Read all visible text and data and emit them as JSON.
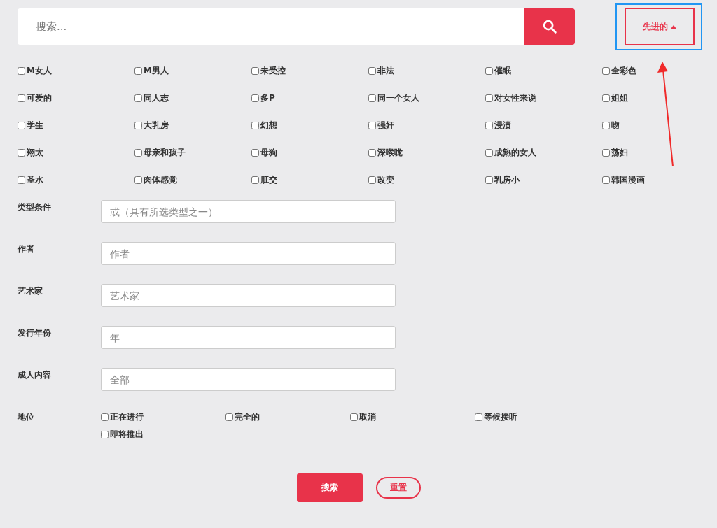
{
  "search": {
    "placeholder": "搜索..."
  },
  "advanced_toggle": {
    "label": "先进的",
    "expanded": true
  },
  "genres": [
    {
      "label": "M女人",
      "checked": false
    },
    {
      "label": "M男人",
      "checked": false
    },
    {
      "label": "未受控",
      "checked": false
    },
    {
      "label": "非法",
      "checked": false
    },
    {
      "label": "催眠",
      "checked": false
    },
    {
      "label": "全彩色",
      "checked": false
    },
    {
      "label": "可爱的",
      "checked": false
    },
    {
      "label": "同人志",
      "checked": false
    },
    {
      "label": "多P",
      "checked": false
    },
    {
      "label": "同一个女人",
      "checked": false
    },
    {
      "label": "对女性来说",
      "checked": false
    },
    {
      "label": "姐姐",
      "checked": false
    },
    {
      "label": "学生",
      "checked": false
    },
    {
      "label": "大乳房",
      "checked": false
    },
    {
      "label": "幻想",
      "checked": false
    },
    {
      "label": "强奸",
      "checked": false
    },
    {
      "label": "浸渍",
      "checked": false
    },
    {
      "label": "吻",
      "checked": false
    },
    {
      "label": "翔太",
      "checked": false
    },
    {
      "label": "母亲和孩子",
      "checked": false
    },
    {
      "label": "母狗",
      "checked": false
    },
    {
      "label": "深喉咙",
      "checked": false
    },
    {
      "label": "成熟的女人",
      "checked": false
    },
    {
      "label": "荡妇",
      "checked": false
    },
    {
      "label": "圣水",
      "checked": false
    },
    {
      "label": "肉体感觉",
      "checked": false
    },
    {
      "label": "肛交",
      "checked": false
    },
    {
      "label": "改变",
      "checked": false
    },
    {
      "label": "乳房小",
      "checked": false
    },
    {
      "label": "韩国漫画",
      "checked": false
    }
  ],
  "fields": [
    {
      "label": "类型条件",
      "placeholder": "或（具有所选类型之一）"
    },
    {
      "label": "作者",
      "placeholder": "作者"
    },
    {
      "label": "艺术家",
      "placeholder": "艺术家"
    },
    {
      "label": "发行年份",
      "placeholder": "年"
    },
    {
      "label": "成人内容",
      "placeholder": "全部"
    }
  ],
  "status": {
    "label": "地位",
    "options": [
      {
        "label": "正在进行",
        "checked": false
      },
      {
        "label": "完全的",
        "checked": false
      },
      {
        "label": "取消",
        "checked": false
      },
      {
        "label": "等候接听",
        "checked": false
      },
      {
        "label": "即将推出",
        "checked": false
      }
    ]
  },
  "buttons": {
    "submit": "搜索",
    "reset": "重置"
  }
}
